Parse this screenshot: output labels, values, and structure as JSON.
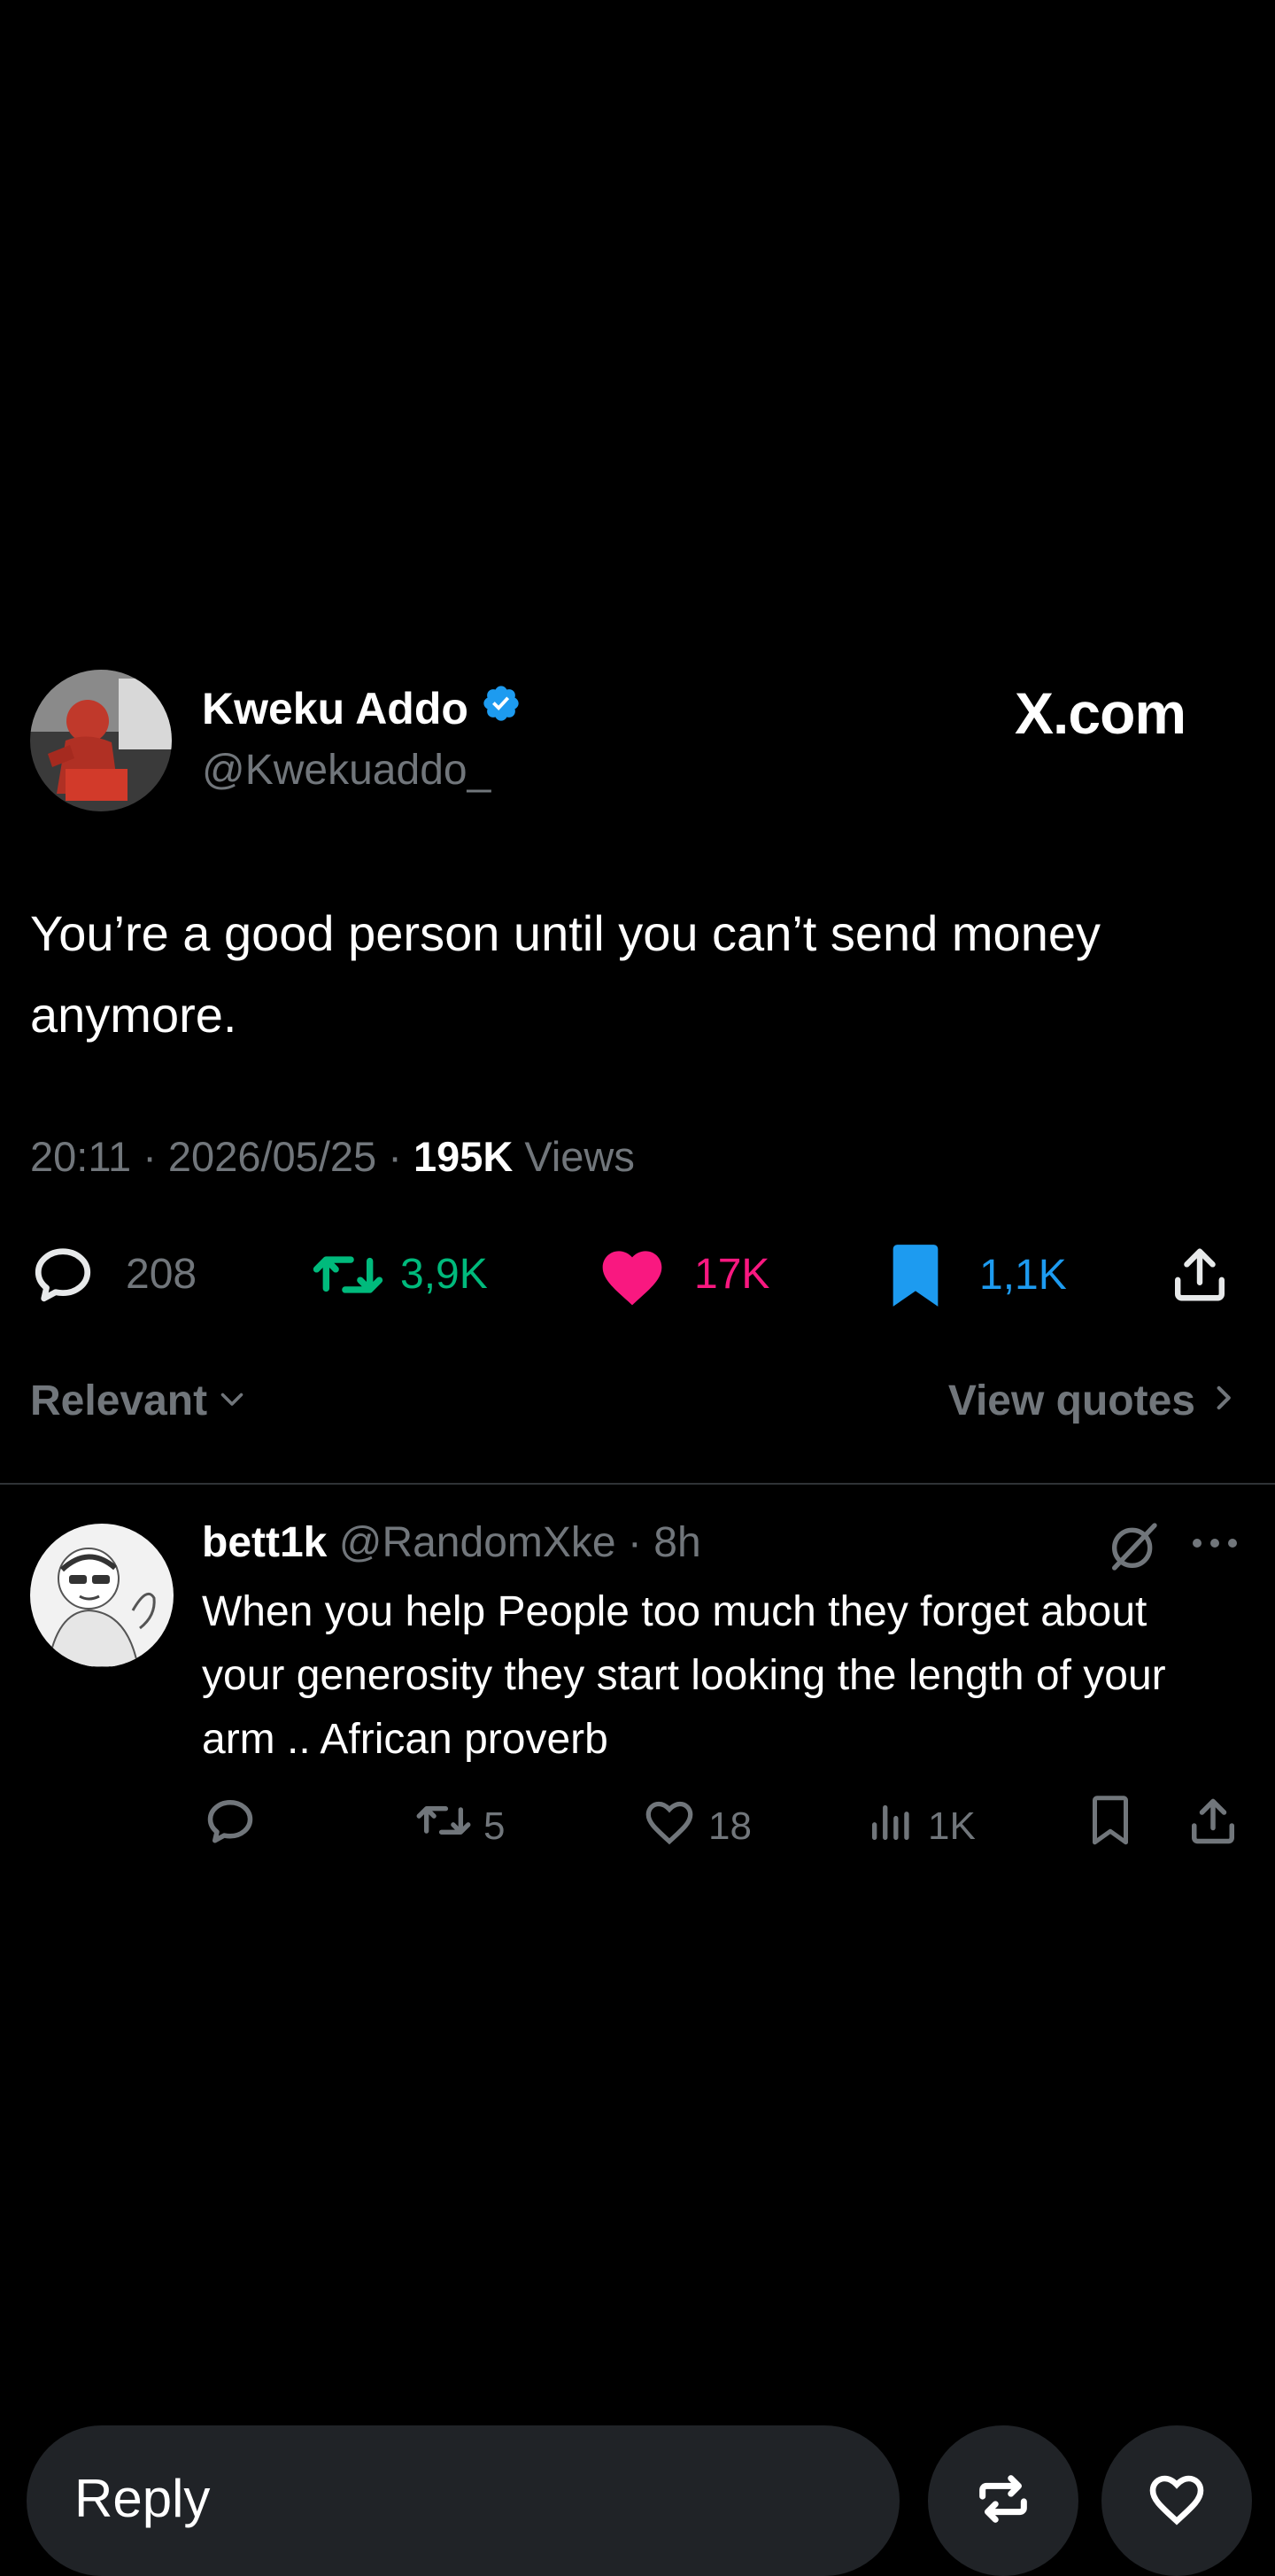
{
  "tweet": {
    "author_name": "Kweku Addo",
    "author_handle": "@Kwekuaddo_",
    "brand": "X.com",
    "text": "You’re a good person until you can’t send money anymore.",
    "time": "20:11",
    "separator": " · ",
    "date": "2026/05/25",
    "views_count": "195K",
    "views_label": " Views",
    "actions": {
      "replies": "208",
      "reposts": "3,9K",
      "likes": "17K",
      "bookmarks": "1,1K"
    },
    "sort_label": "Relevant",
    "view_quotes_label": "View quotes"
  },
  "reply": {
    "name": "bett1k",
    "handle": "@RandomXke",
    "time_ago": "8h",
    "text": "When you help People too much they forget about your generosity they start looking the length of your  arm .. African proverb",
    "actions": {
      "reposts": "5",
      "likes": "18",
      "views": "1K"
    }
  },
  "bottom_bar": {
    "reply_placeholder": "Reply"
  },
  "colors": {
    "background": "#000000",
    "verified": "#1d9bf0",
    "repost_active": "#00ba7c",
    "like_active": "#f91880",
    "bookmark_active": "#1d9bf0",
    "muted": "#71767b"
  },
  "icons": [
    "verified-badge-icon",
    "reply-icon",
    "repost-icon",
    "heart-icon",
    "bookmark-icon",
    "share-icon",
    "chevron-down-icon",
    "chevron-right-icon",
    "grok-icon",
    "more-icon",
    "views-icon"
  ]
}
